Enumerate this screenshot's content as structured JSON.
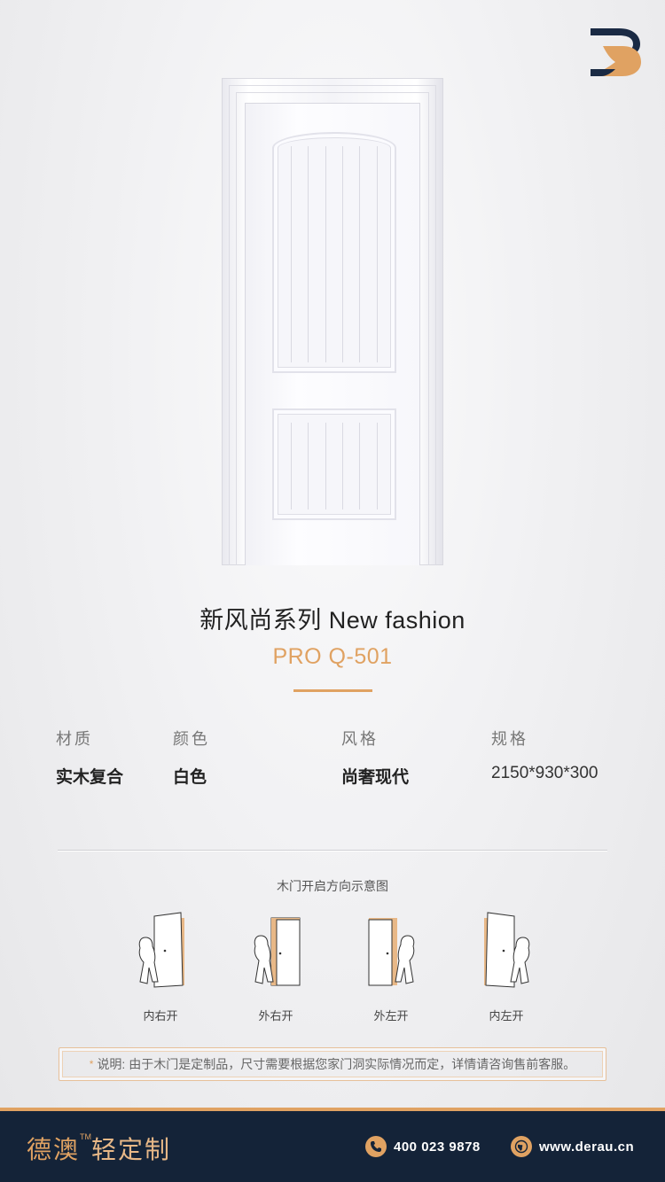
{
  "product": {
    "series_title": "新风尚系列  New fashion",
    "model": "PRO Q-501"
  },
  "specs": [
    {
      "label": "材质",
      "value": "实木复合"
    },
    {
      "label": "颜色",
      "value": "白色"
    },
    {
      "label": "风格",
      "value": "尚奢现代"
    },
    {
      "label": "规格",
      "value": "2150*930*300"
    }
  ],
  "direction": {
    "title": "木门开启方向示意图",
    "items": [
      {
        "label": "内右开"
      },
      {
        "label": "外右开"
      },
      {
        "label": "外左开"
      },
      {
        "label": "内左开"
      }
    ]
  },
  "note": {
    "star": "*",
    "text": "说明: 由于木门是定制品，尺寸需要根据您家门洞实际情况而定，详情请咨询售前客服。"
  },
  "footer": {
    "brand": "德澳",
    "tm": "TM",
    "brand_suffix": "轻定制",
    "phone": "400 023 9878",
    "website": "www.derau.cn"
  },
  "colors": {
    "accent": "#e0a262",
    "footer_bg": "#142338",
    "logo_navy": "#1a2a44"
  },
  "icons": [
    "brand-logo-icon",
    "phone-icon",
    "globe-icon"
  ]
}
